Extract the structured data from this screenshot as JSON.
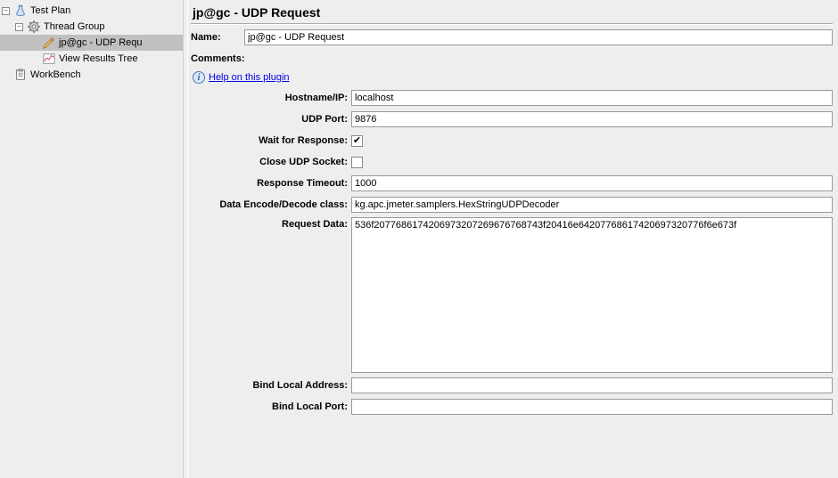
{
  "tree": {
    "testPlan": "Test Plan",
    "threadGroup": "Thread Group",
    "udpRequest": "jp@gc - UDP Requ",
    "viewResults": "View Results Tree",
    "workBench": "WorkBench"
  },
  "panel": {
    "title": "jp@gc - UDP Request",
    "nameLabel": "Name:",
    "nameValue": "jp@gc - UDP Request",
    "commentsLabel": "Comments:",
    "helpLink": "Help on this plugin",
    "hostnameLabel": "Hostname/IP:",
    "hostnameValue": "localhost",
    "portLabel": "UDP Port:",
    "portValue": "9876",
    "waitLabel": "Wait for Response:",
    "waitChecked": "✔",
    "closeLabel": "Close UDP Socket:",
    "closeChecked": "",
    "timeoutLabel": "Response Timeout:",
    "timeoutValue": "1000",
    "decodeLabel": "Data Encode/Decode class:",
    "decodeValue": "kg.apc.jmeter.samplers.HexStringUDPDecoder",
    "requestDataLabel": "Request Data:",
    "requestDataValue": "536f2077686174206973207269676768743f20416e64207768617420697320776f6e673f",
    "bindAddrLabel": "Bind Local Address:",
    "bindAddrValue": "",
    "bindPortLabel": "Bind Local Port:",
    "bindPortValue": ""
  }
}
